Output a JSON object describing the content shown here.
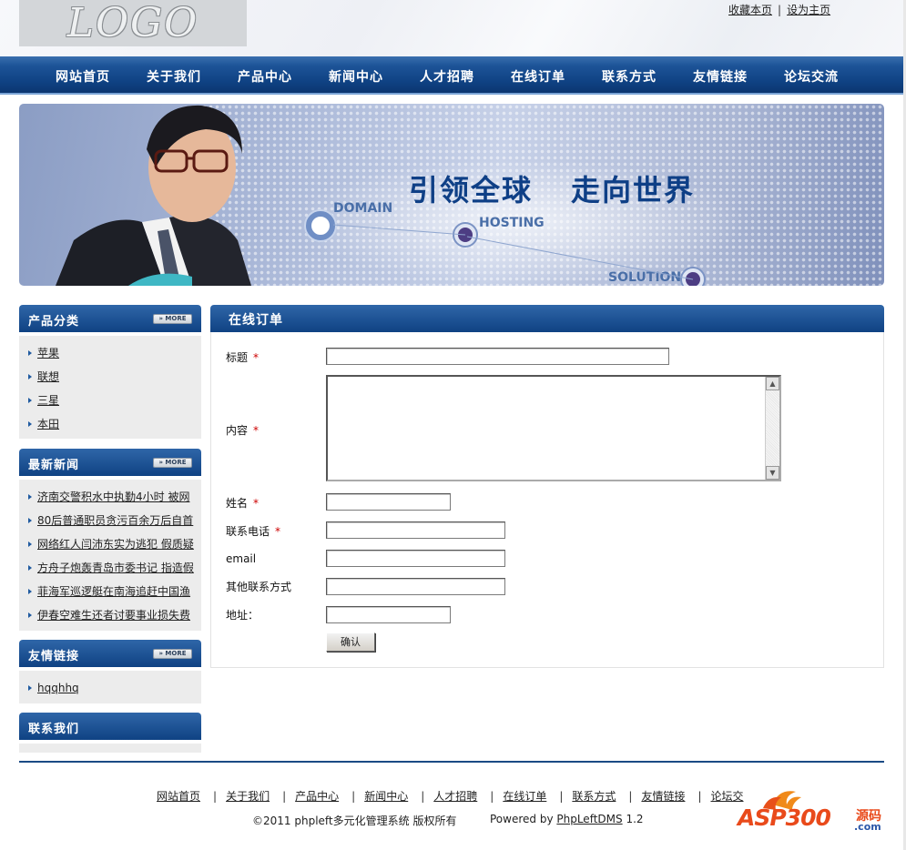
{
  "header": {
    "logo_text": "LOGO",
    "links": [
      "收藏本页",
      "设为主页"
    ],
    "link_sep": "|"
  },
  "nav": {
    "items": [
      "网站首页",
      "关于我们",
      "产品中心",
      "新闻中心",
      "人才招聘",
      "在线订单",
      "联系方式",
      "友情链接",
      "论坛交流"
    ]
  },
  "banner": {
    "slogan_left": "引领全球",
    "slogan_right": "走向世界",
    "labels": [
      "DOMAIN",
      "HOSTING",
      "SOLUTION"
    ]
  },
  "sidebar": {
    "more_label": "» MORE",
    "categories": {
      "title": "产品分类",
      "items": [
        "苹果",
        "联想",
        "三星",
        "本田"
      ]
    },
    "news": {
      "title": "最新新闻",
      "items": [
        "济南交警积水中执勤4小时 被网",
        "80后普通职员贪污百余万后自首",
        "网络红人闫沛东实为逃犯 假质疑",
        "方舟子炮轰青岛市委书记 指造假",
        "菲海军巡逻艇在南海追赶中国渔",
        "伊春空难生还者讨要事业损失费"
      ]
    },
    "links": {
      "title": "友情链接",
      "items": [
        "hqqhhq"
      ]
    },
    "contact": {
      "title": "联系我们"
    }
  },
  "main": {
    "title": "在线订单",
    "required_mark": "*",
    "fields": {
      "title_label": "标题",
      "content_label": "内容",
      "name_label": "姓名",
      "phone_label": "联系电话",
      "email_label": "email",
      "other_label": "其他联系方式",
      "address_label": "地址："
    },
    "submit_label": "确认"
  },
  "footer": {
    "links": [
      "网站首页",
      "关于我们",
      "产品中心",
      "新闻中心",
      "人才招聘",
      "在线订单",
      "联系方式",
      "友情链接",
      "论坛交"
    ],
    "sep": "|",
    "copyright": "©2011 phpleft多元化管理系统 版权所有",
    "powered_prefix": "Powered by ",
    "powered_link": "PhpLeftDMS",
    "powered_version": " 1.2",
    "watermark_text": "ASP300",
    "watermark_sub": "源码",
    "watermark_domain": ".com"
  },
  "colors": {
    "nav_blue": "#0f4283",
    "required_red": "#cc0000",
    "side_bg": "#ececec"
  }
}
